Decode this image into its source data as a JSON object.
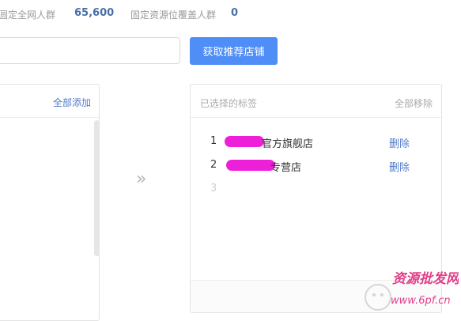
{
  "stats": {
    "total_label": "圆定全网人群",
    "total_value": "65,600",
    "coverage_label": "固定资源位覆盖人群",
    "coverage_value": "0"
  },
  "search": {
    "value": "",
    "placeholder": ""
  },
  "fetch_button": {
    "label": "获取推荐店铺",
    "color": "#4f8ef7"
  },
  "left_panel": {
    "add_all": "全部添加"
  },
  "transfer": {
    "icon": "double-chevron-right-icon",
    "glyph": "»"
  },
  "right_panel": {
    "title": "已选择的标签",
    "remove_all": "全部移除",
    "items": [
      {
        "num": "1",
        "name": "官方旗舰店",
        "delete": "删除"
      },
      {
        "num": "2",
        "name": "专营店",
        "delete": "删除"
      }
    ],
    "next_num": "3"
  },
  "watermark": {
    "text": "资源批发网",
    "url": "www.6pf.cn"
  },
  "colors": {
    "accent": "#4f8ef7",
    "link": "#4f7ac9",
    "redaction": "#ee1fd9",
    "watermark": "#e0408a"
  }
}
